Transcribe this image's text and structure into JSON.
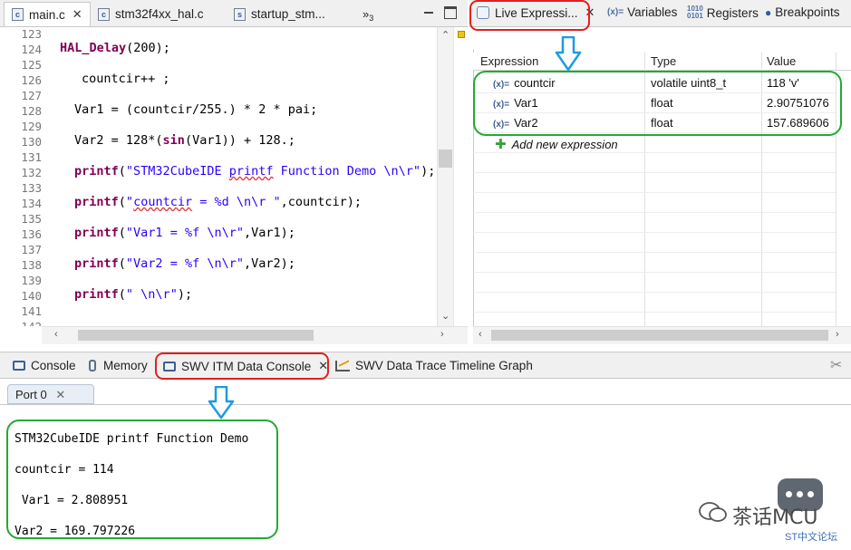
{
  "editor": {
    "tabs": [
      {
        "label": "main.c",
        "icon": "c"
      },
      {
        "label": "stm32f4xx_hal.c",
        "icon": "c"
      },
      {
        "label": "startup_stm...",
        "icon": "s"
      }
    ],
    "overflow_count": "3",
    "lines": [
      {
        "n": "123",
        "code": ""
      },
      {
        "n": "124",
        "code": "HAL_Delay(200);"
      },
      {
        "n": "125",
        "code": ""
      },
      {
        "n": "126",
        "code": "countcir++ ;"
      },
      {
        "n": "127",
        "code": ""
      },
      {
        "n": "128",
        "code": "Var1 = (countcir/255.) * 2 * pai;"
      },
      {
        "n": "129",
        "code": ""
      },
      {
        "n": "130",
        "code": "Var2 = 128*(sin(Var1)) + 128.;"
      },
      {
        "n": "131",
        "code": ""
      },
      {
        "n": "132",
        "code": "printf(\"STM32CubeIDE printf Function Demo \\n\\r\");"
      },
      {
        "n": "133",
        "code": ""
      },
      {
        "n": "134",
        "code": "printf(\"countcir = %d \\n\\r \",countcir);"
      },
      {
        "n": "135",
        "code": ""
      },
      {
        "n": "136",
        "code": "printf(\"Var1 = %f \\n\\r\",Var1);"
      },
      {
        "n": "137",
        "code": ""
      },
      {
        "n": "138",
        "code": "printf(\"Var2 = %f \\n\\r\",Var2);"
      },
      {
        "n": "139",
        "code": ""
      },
      {
        "n": "140",
        "code": "printf(\" \\n\\r\");"
      },
      {
        "n": "141",
        "code": ""
      },
      {
        "n": "142",
        "code": ""
      }
    ]
  },
  "right_tabs": {
    "live": "Live Expressi...",
    "variables": "Variables",
    "registers": "Registers",
    "breakpoints": "Breakpoints"
  },
  "expressions": {
    "headers": {
      "expression": "Expression",
      "type": "Type",
      "value": "Value"
    },
    "rows": [
      {
        "name": "countcir",
        "type": "volatile uint8_t",
        "value": "118 'v'"
      },
      {
        "name": "Var1",
        "type": "float",
        "value": "2.90751076"
      },
      {
        "name": "Var2",
        "type": "float",
        "value": "157.689606"
      }
    ],
    "add_new": "Add new expression"
  },
  "bottom_tabs": {
    "console": "Console",
    "memory": "Memory",
    "swv_itm": "SWV ITM Data Console",
    "swv_trace": "SWV Data Trace Timeline Graph"
  },
  "port_tab": "Port 0",
  "console_lines": [
    "STM32CubeIDE printf Function Demo",
    "countcir = 114",
    " Var1 = 2.808951",
    "Var2 = 169.797226"
  ],
  "watermark": {
    "brand": "茶话MCU",
    "sub": "ST中文论坛"
  },
  "colors": {
    "annotation_red": "#e02020",
    "annotation_green": "#22aa33",
    "annotation_arrow": "#1e9be0",
    "keyword": "#7f0055",
    "string": "#2a00ff"
  }
}
